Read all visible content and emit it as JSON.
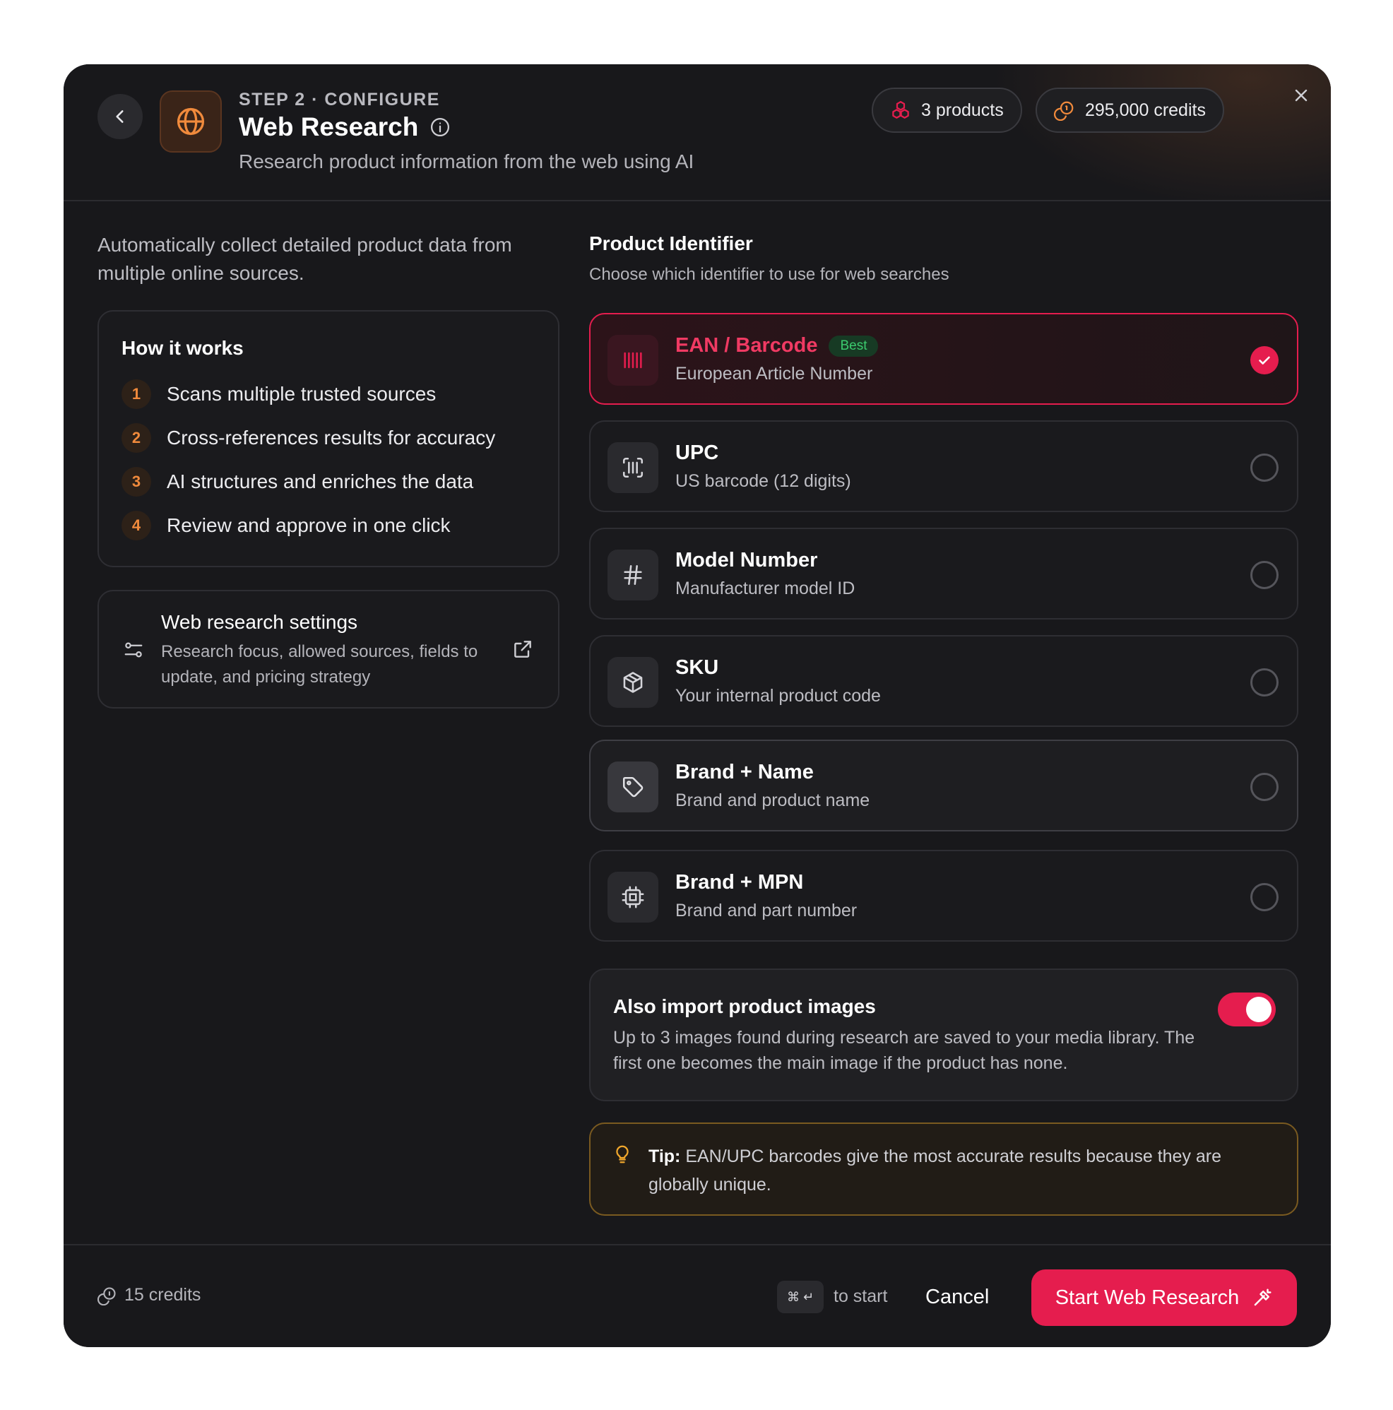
{
  "header": {
    "step_label": "STEP 2 · CONFIGURE",
    "title": "Web Research",
    "subtitle": "Research product information from the web using AI",
    "products_pill": "3 products",
    "credits_pill": "295,000 credits"
  },
  "left": {
    "intro": "Automatically collect detailed product data from multiple online sources.",
    "how_it_works": {
      "title": "How it works",
      "steps": [
        {
          "num": "1",
          "text": "Scans multiple trusted sources"
        },
        {
          "num": "2",
          "text": "Cross-references results for accuracy"
        },
        {
          "num": "3",
          "text": "AI structures and enriches the data"
        },
        {
          "num": "4",
          "text": "Review and approve in one click"
        }
      ]
    },
    "settings": {
      "title": "Web research settings",
      "desc": "Research focus, allowed sources, fields to update, and pricing strategy"
    }
  },
  "identifier": {
    "title": "Product Identifier",
    "subtitle": "Choose which identifier to use for web searches",
    "options": [
      {
        "label": "EAN / Barcode",
        "badge": "Best",
        "desc": "European Article Number",
        "icon": "barcode-icon",
        "selected": true
      },
      {
        "label": "UPC",
        "desc": "US barcode (12 digits)",
        "icon": "scan-barcode-icon",
        "selected": false
      },
      {
        "label": "Model Number",
        "desc": "Manufacturer model ID",
        "icon": "hash-icon",
        "selected": false
      },
      {
        "label": "SKU",
        "desc": "Your internal product code",
        "icon": "package-icon",
        "selected": false
      },
      {
        "label": "Brand + Name",
        "desc": "Brand and product name",
        "icon": "tag-icon",
        "selected": false
      },
      {
        "label": "Brand + MPN",
        "desc": "Brand and part number",
        "icon": "chip-icon",
        "selected": false
      }
    ]
  },
  "images": {
    "title": "Also import product images",
    "desc": "Up to 3 images found during research are saved to your media library. The first one becomes the main image if the product has none.",
    "enabled": true
  },
  "tip": {
    "label": "Tip:",
    "text": " EAN/UPC barcodes give the most accurate results because they are globally unique."
  },
  "footer": {
    "credits": "15 credits",
    "shortcut_keys": "⌘ ↵",
    "shortcut_hint": "to start",
    "cancel_label": "Cancel",
    "start_label": "Start Web Research"
  },
  "colors": {
    "accent": "#e51d4e",
    "orange": "#f08a3c",
    "green": "#3ccb6e",
    "tip_border": "#7a5a20"
  }
}
